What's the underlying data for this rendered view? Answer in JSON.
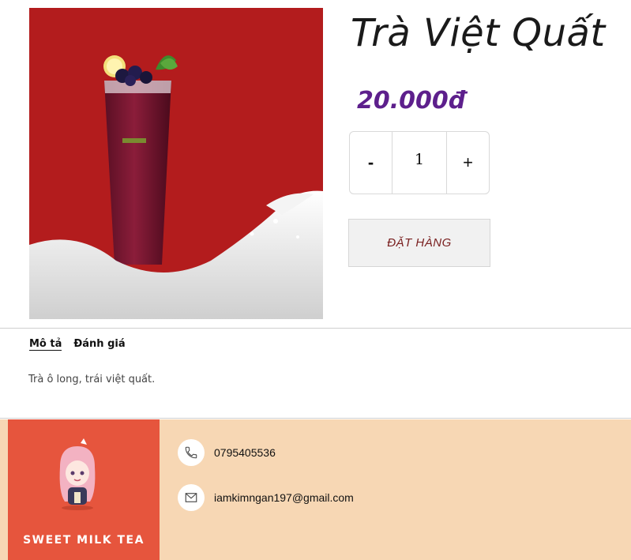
{
  "product": {
    "name": "Trà Việt Quất",
    "price": "20.000đ",
    "quantity": "1",
    "minus_label": "-",
    "plus_label": "+",
    "order_label": "ĐẶT HÀNG"
  },
  "tabs": [
    {
      "label": "Mô tả",
      "active": true
    },
    {
      "label": "Đánh giá",
      "active": false
    }
  ],
  "description": "Trà ô long, trái việt quất.",
  "footer": {
    "brand": "SWEET MILK TEA",
    "phone": "0795405536",
    "email": "iamkimngan197@gmail.com",
    "phone_icon": "phone-icon",
    "email_icon": "envelope-icon"
  },
  "colors": {
    "price": "#5d1f8c",
    "footer_bg": "#f7d7b4",
    "logo_bg": "#e6553d",
    "image_bg": "#b31c1d"
  }
}
